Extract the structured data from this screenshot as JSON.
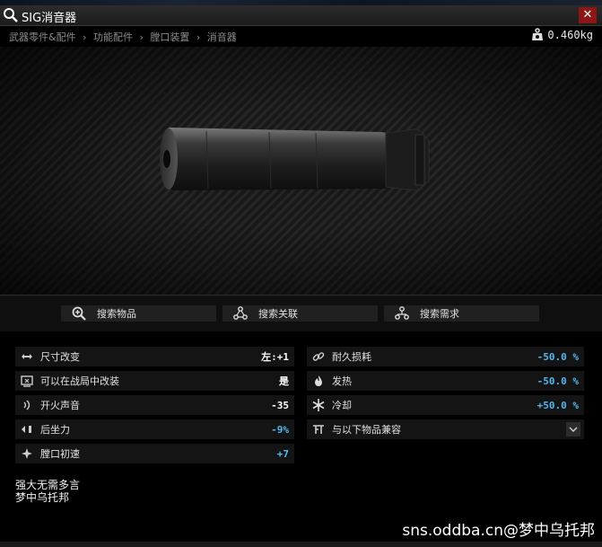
{
  "window": {
    "title": "SIG消音器",
    "close_label": "✕"
  },
  "breadcrumb": [
    "武器零件&配件",
    "›",
    "功能配件",
    "›",
    "膛口装置",
    "›",
    "消音器"
  ],
  "weight": "0.460kg",
  "actions": {
    "search_item": "搜索物品",
    "search_links": "搜索关联",
    "search_required": "搜索需求"
  },
  "stats_left": [
    {
      "icon": "size-change-icon",
      "label": "尺寸改变",
      "value": "左:+1",
      "color": "white"
    },
    {
      "icon": "modify-in-raid-icon",
      "label": "可以在战局中改装",
      "value": "是",
      "color": "white"
    },
    {
      "icon": "loudness-icon",
      "label": "开火声音",
      "value": "-35",
      "color": "white"
    },
    {
      "icon": "recoil-icon",
      "label": "后坐力",
      "value": "-9%",
      "color": "blue"
    },
    {
      "icon": "velocity-icon",
      "label": "膛口初速",
      "value": "+7",
      "color": "blue"
    }
  ],
  "stats_right": [
    {
      "icon": "durability-link-icon",
      "label": "耐久损耗",
      "value": "-50.0 %",
      "color": "blue"
    },
    {
      "icon": "flame-icon",
      "label": "发热",
      "value": "-50.0 %",
      "color": "blue"
    },
    {
      "icon": "snowflake-icon",
      "label": "冷却",
      "value": "+50.0 %",
      "color": "blue"
    },
    {
      "icon": "compatible-icon",
      "label": "与以下物品兼容",
      "value": "",
      "color": "white"
    }
  ],
  "description": [
    "强大无需多言",
    "梦中乌托邦"
  ],
  "watermark": "sns.oddba.cn@梦中乌托邦",
  "colors": {
    "accent_blue": "#55b7f0",
    "close_red": "#8c1616"
  }
}
